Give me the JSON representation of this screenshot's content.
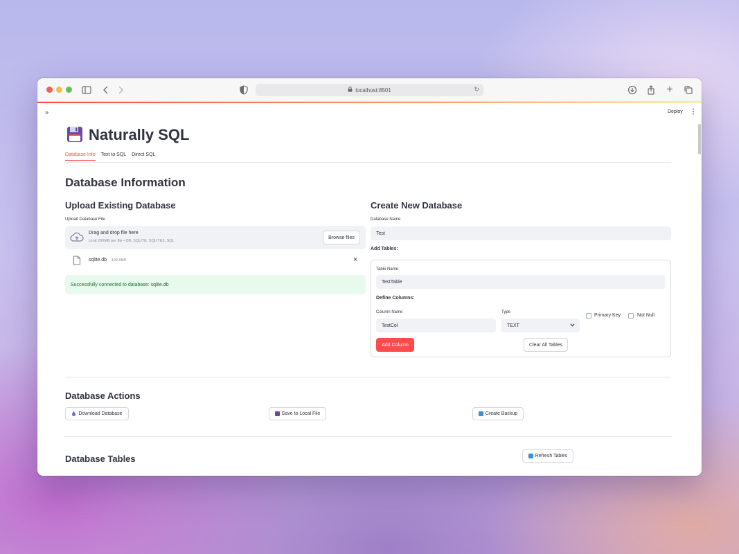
{
  "browser": {
    "url": "localhost:8501"
  },
  "app": {
    "deploy_label": "Deploy",
    "title": "Naturally SQL",
    "tabs": [
      {
        "label": "Database Info",
        "active": true
      },
      {
        "label": "Text to SQL",
        "active": false
      },
      {
        "label": "Direct SQL",
        "active": false
      }
    ]
  },
  "database_info": {
    "heading": "Database Information",
    "upload": {
      "heading": "Upload Existing Database",
      "field_label": "Upload Database File",
      "drop_title": "Drag and drop file here",
      "drop_hint": "Limit 200MB per file • DB, SQLITE, SQLITE3, SQL",
      "browse_label": "Browse files",
      "file_name": "sqlite.db",
      "file_size": "192.0KB",
      "success_message": "Successfully connected to database: sqlite.db"
    },
    "create": {
      "heading": "Create New Database",
      "db_name_label": "Database Name",
      "db_name_value": "Test",
      "add_tables_label": "Add Tables:",
      "table_name_label": "Table Name",
      "table_name_value": "TestTable",
      "define_columns_label": "Define Columns:",
      "column_name_label": "Column Name",
      "column_name_value": "TestCol",
      "type_label": "Type",
      "type_value": "TEXT",
      "primary_key_label": "Primary Key",
      "primary_key_checked": false,
      "not_null_label": "Not Null",
      "not_null_checked": false,
      "add_column_label": "Add Column",
      "clear_tables_label": "Clear All Tables"
    }
  },
  "actions": {
    "heading": "Database Actions",
    "download_label": "Download Database",
    "save_label": "Save to Local File",
    "backup_label": "Create Backup"
  },
  "tables": {
    "heading": "Database Tables",
    "refresh_label": "Refresh Tables"
  },
  "colors": {
    "accent": "#ff4b4b",
    "success_bg": "#e8f9ee",
    "success_text": "#177233",
    "input_bg": "#f0f2f6"
  }
}
